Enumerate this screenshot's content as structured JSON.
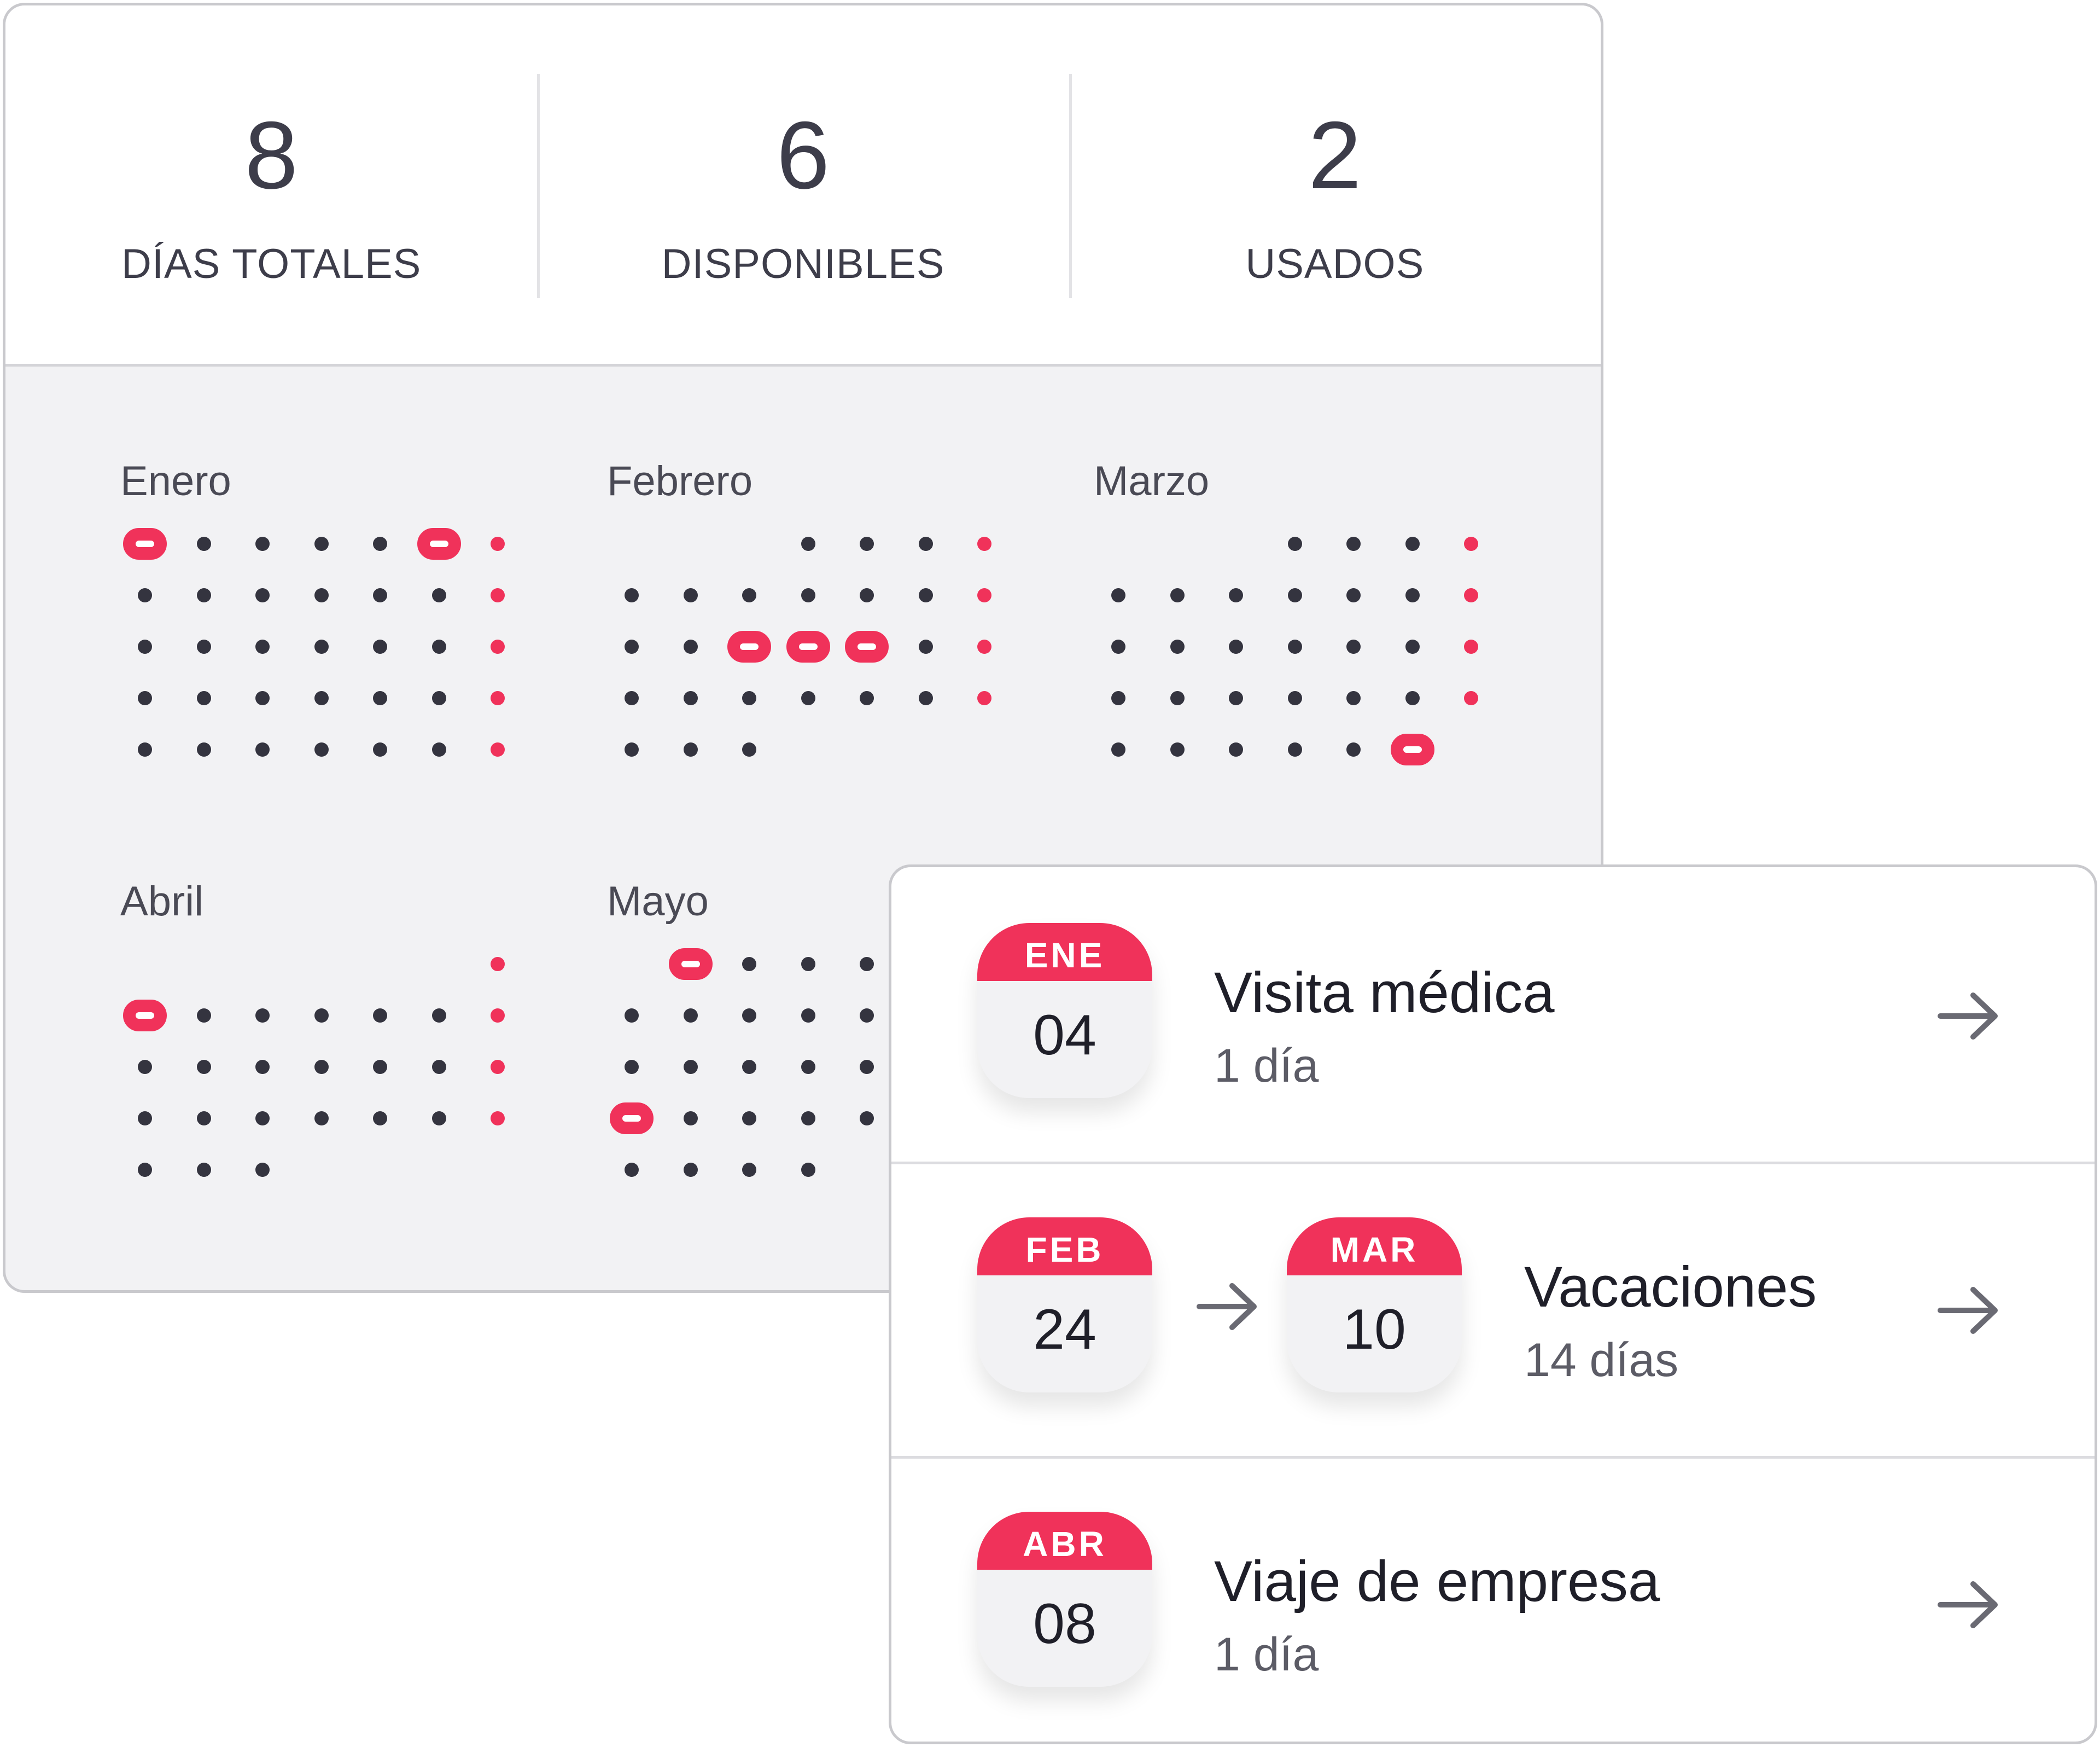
{
  "colors": {
    "accent": "#f0325a",
    "text_dark": "#34343f",
    "card_gray": "#f2f2f4"
  },
  "stats": [
    {
      "value": "8",
      "label": "DÍAS TOTALES"
    },
    {
      "value": "6",
      "label": "DISPONIBLES"
    },
    {
      "value": "2",
      "label": "USADOS"
    }
  ],
  "months": [
    {
      "name": "Enero",
      "rows": [
        [
          "M",
          "D",
          "D",
          "D",
          "D",
          "M",
          "W"
        ],
        [
          "D",
          "D",
          "D",
          "D",
          "D",
          "D",
          "W"
        ],
        [
          "D",
          "D",
          "D",
          "D",
          "D",
          "D",
          "W"
        ],
        [
          "D",
          "D",
          "D",
          "D",
          "D",
          "D",
          "W"
        ],
        [
          "D",
          "D",
          "D",
          "D",
          "D",
          "D",
          "W"
        ]
      ]
    },
    {
      "name": "Febrero",
      "rows": [
        [
          "",
          "",
          "",
          "D",
          "D",
          "D",
          "W"
        ],
        [
          "D",
          "D",
          "D",
          "D",
          "D",
          "D",
          "W"
        ],
        [
          "D",
          "D",
          "M",
          "M",
          "M",
          "D",
          "W"
        ],
        [
          "D",
          "D",
          "D",
          "D",
          "D",
          "D",
          "W"
        ],
        [
          "D",
          "D",
          "D",
          "",
          "",
          "",
          ""
        ]
      ]
    },
    {
      "name": "Marzo",
      "rows": [
        [
          "",
          "",
          "",
          "D",
          "D",
          "D",
          "W"
        ],
        [
          "D",
          "D",
          "D",
          "D",
          "D",
          "D",
          "W"
        ],
        [
          "D",
          "D",
          "D",
          "D",
          "D",
          "D",
          "W"
        ],
        [
          "D",
          "D",
          "D",
          "D",
          "D",
          "D",
          "W"
        ],
        [
          "D",
          "D",
          "D",
          "D",
          "D",
          "M",
          ""
        ]
      ]
    },
    {
      "name": "Abril",
      "rows": [
        [
          "",
          "",
          "",
          "",
          "",
          "",
          "W"
        ],
        [
          "M",
          "D",
          "D",
          "D",
          "D",
          "D",
          "W"
        ],
        [
          "D",
          "D",
          "D",
          "D",
          "D",
          "D",
          "W"
        ],
        [
          "D",
          "D",
          "D",
          "D",
          "D",
          "D",
          "W"
        ],
        [
          "D",
          "D",
          "D",
          "",
          "",
          "",
          ""
        ]
      ]
    },
    {
      "name": "Mayo",
      "rows": [
        [
          "",
          "M",
          "D",
          "D",
          "D",
          "",
          ""
        ],
        [
          "D",
          "D",
          "D",
          "D",
          "D",
          "",
          ""
        ],
        [
          "D",
          "D",
          "D",
          "D",
          "D",
          "",
          ""
        ],
        [
          "M",
          "D",
          "D",
          "D",
          "D",
          "",
          ""
        ],
        [
          "D",
          "D",
          "D",
          "D",
          "",
          "",
          ""
        ]
      ]
    }
  ],
  "events": [
    {
      "title": "Visita médica",
      "duration": "1 día",
      "start": {
        "month": "ENE",
        "day": "04"
      }
    },
    {
      "title": "Vacaciones",
      "duration": "14 días",
      "start": {
        "month": "FEB",
        "day": "24"
      },
      "end": {
        "month": "MAR",
        "day": "10"
      }
    },
    {
      "title": "Viaje de empresa",
      "duration": "1 día",
      "start": {
        "month": "ABR",
        "day": "08"
      }
    }
  ],
  "icons": {
    "row_arrow": "arrow-right-icon",
    "range_arrow": "arrow-right-icon"
  }
}
